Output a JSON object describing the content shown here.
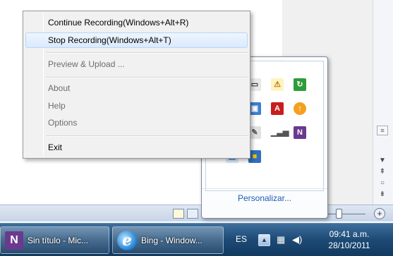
{
  "context_menu": {
    "items": [
      {
        "label": "Continue Recording(Windows+Alt+R)",
        "enabled": true
      },
      {
        "label": "Stop Recording(Windows+Alt+T)",
        "enabled": true,
        "highlighted": true
      },
      {
        "label": "Preview & Upload ...",
        "enabled": false
      },
      {
        "label": "About",
        "enabled": false
      },
      {
        "label": "Help",
        "enabled": false
      },
      {
        "label": "Options",
        "enabled": false
      },
      {
        "label": "Exit",
        "enabled": true
      }
    ]
  },
  "tray_flyout": {
    "customize_link": "Personalizar..."
  },
  "taskbar": {
    "buttons": [
      {
        "label": "Sin título - Mic...",
        "icon": "onenote-icon"
      },
      {
        "label": "Bing - Window...",
        "icon": "internet-explorer-icon"
      }
    ],
    "language": "ES",
    "time": "09:41 a.m.",
    "date": "28/10/2011"
  },
  "colors": {
    "taskbar": "#1d4a75",
    "menu_bg": "#f1f1f1",
    "menu_highlight": "#dbeafc",
    "link": "#1a5fb4"
  }
}
